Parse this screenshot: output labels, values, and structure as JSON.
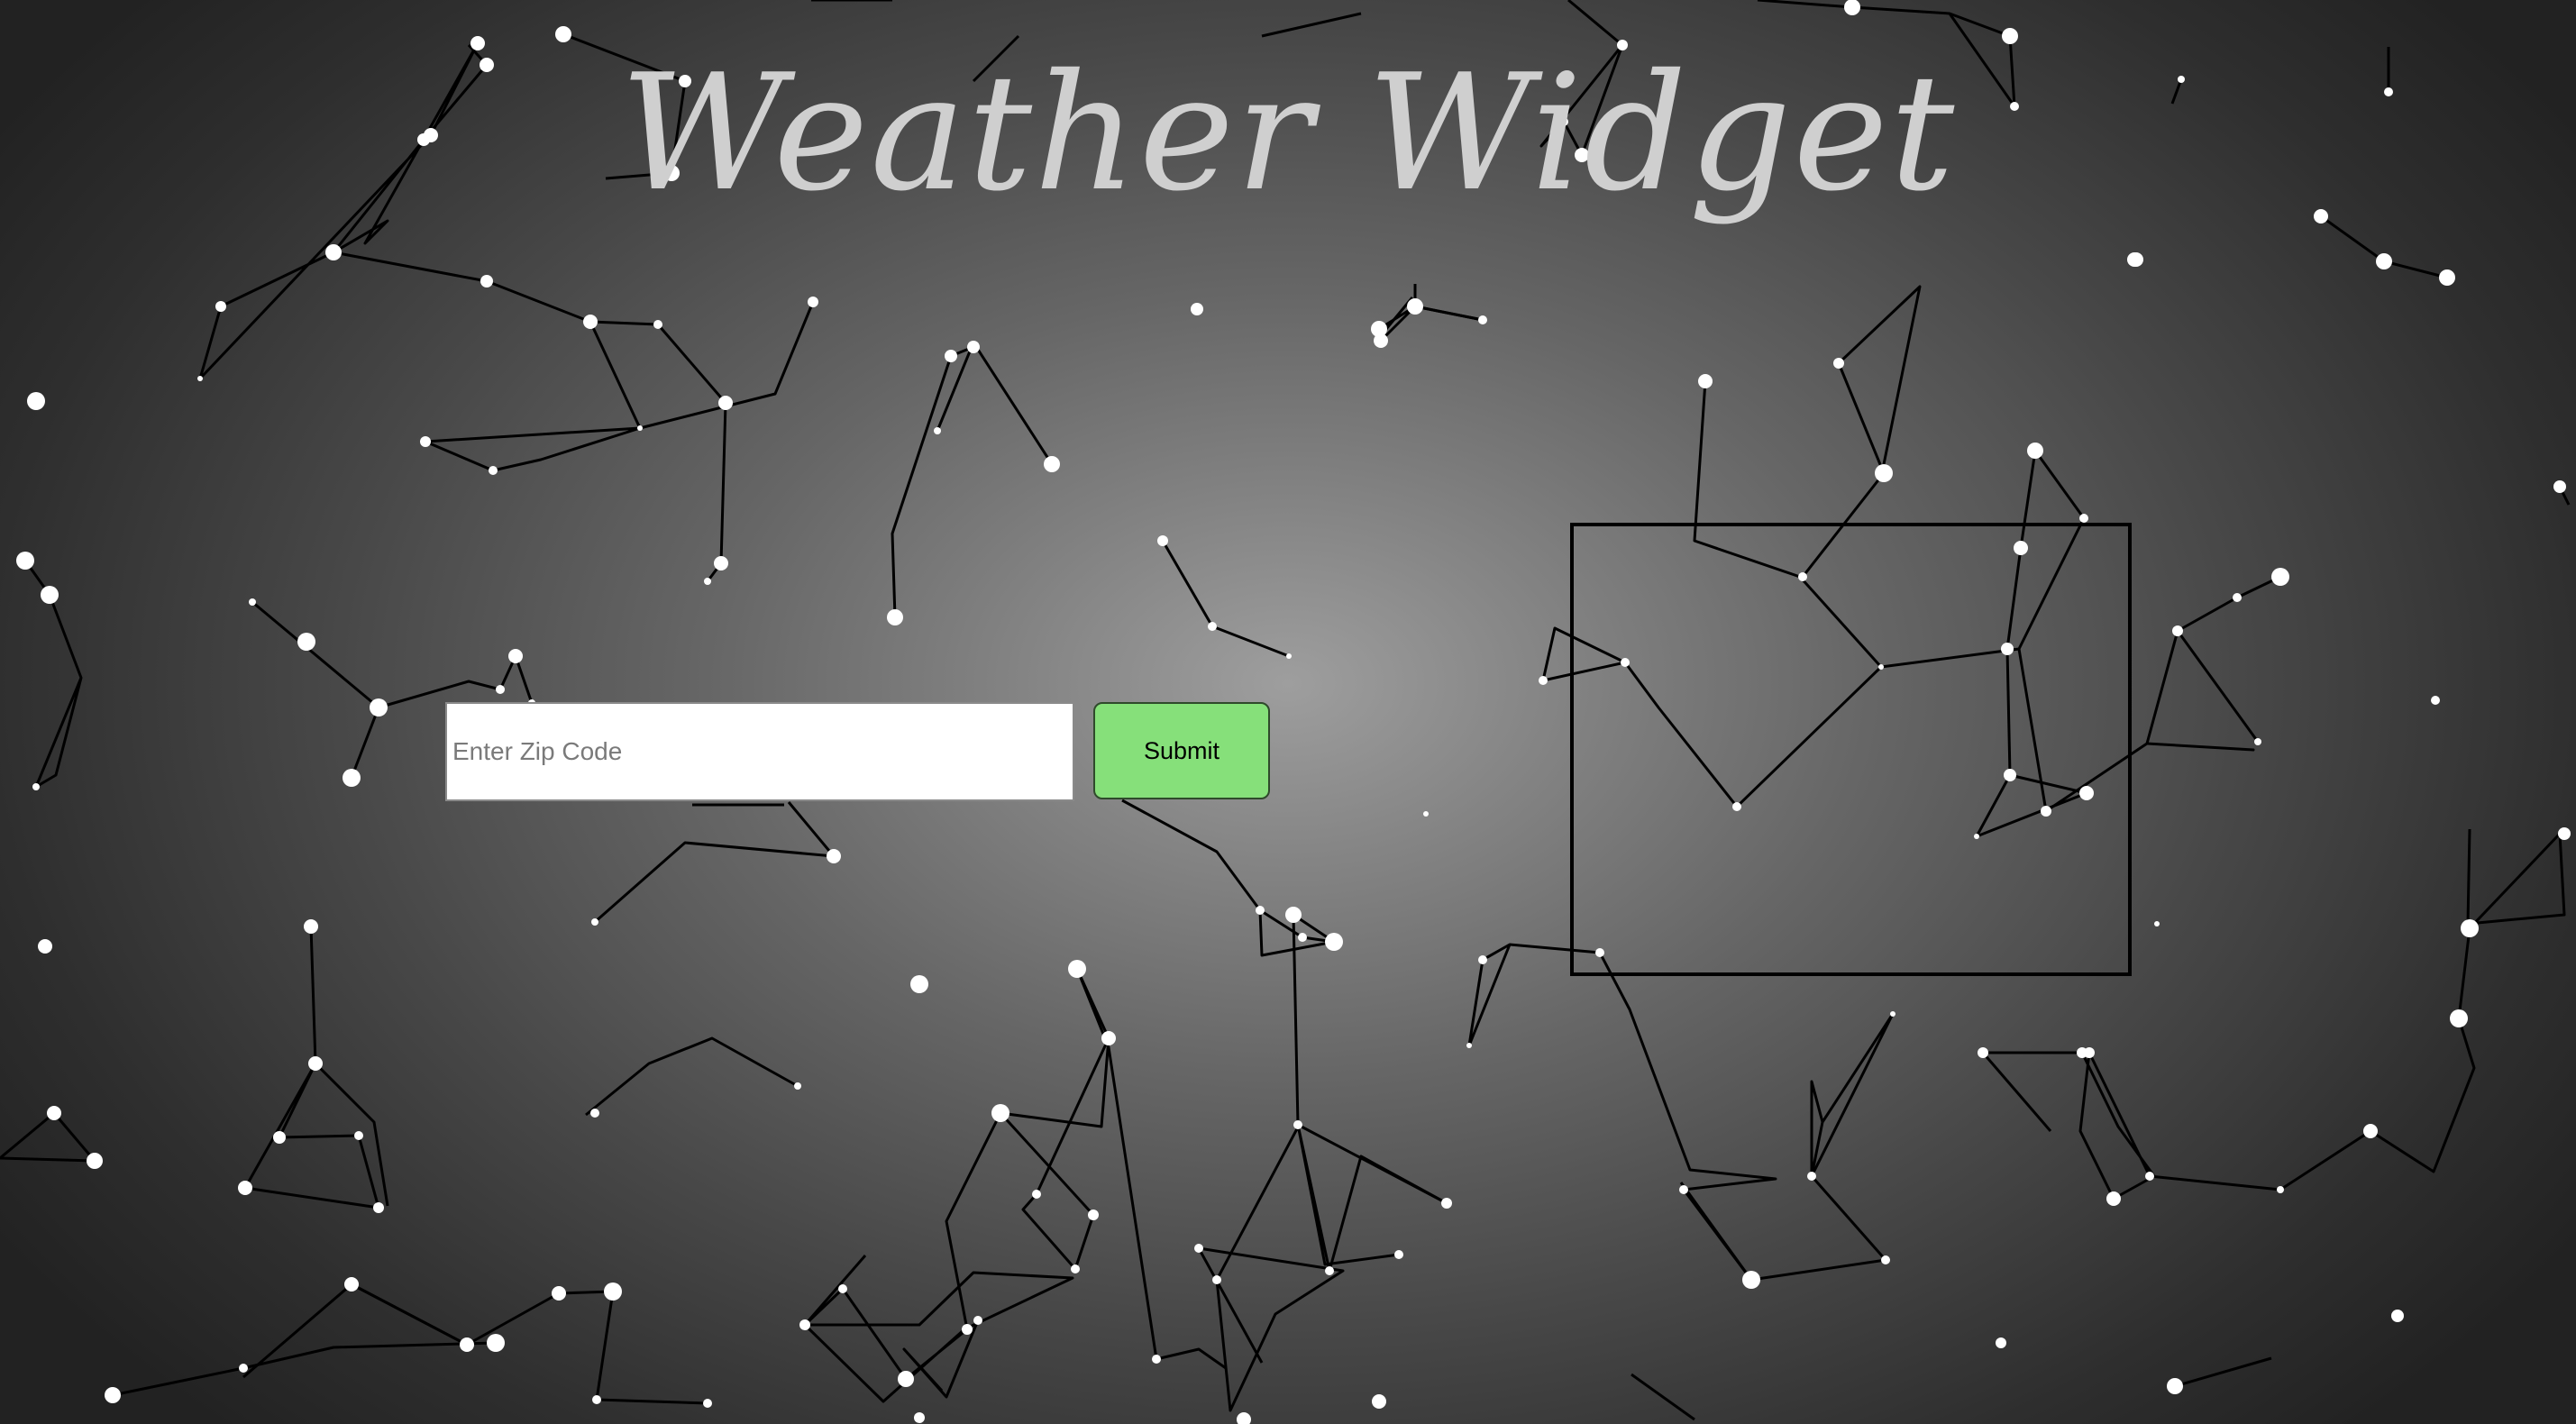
{
  "header": {
    "title": "Weather Widget"
  },
  "form": {
    "zip_placeholder": "Enter Zip Code",
    "zip_value": "",
    "submit_label": "Submit"
  },
  "weather_panel": {
    "content": ""
  },
  "colors": {
    "title": "#cfcfcf",
    "submit_background": "#86e07a",
    "particle_fill": "#ffffff",
    "particle_link": "#000000"
  }
}
